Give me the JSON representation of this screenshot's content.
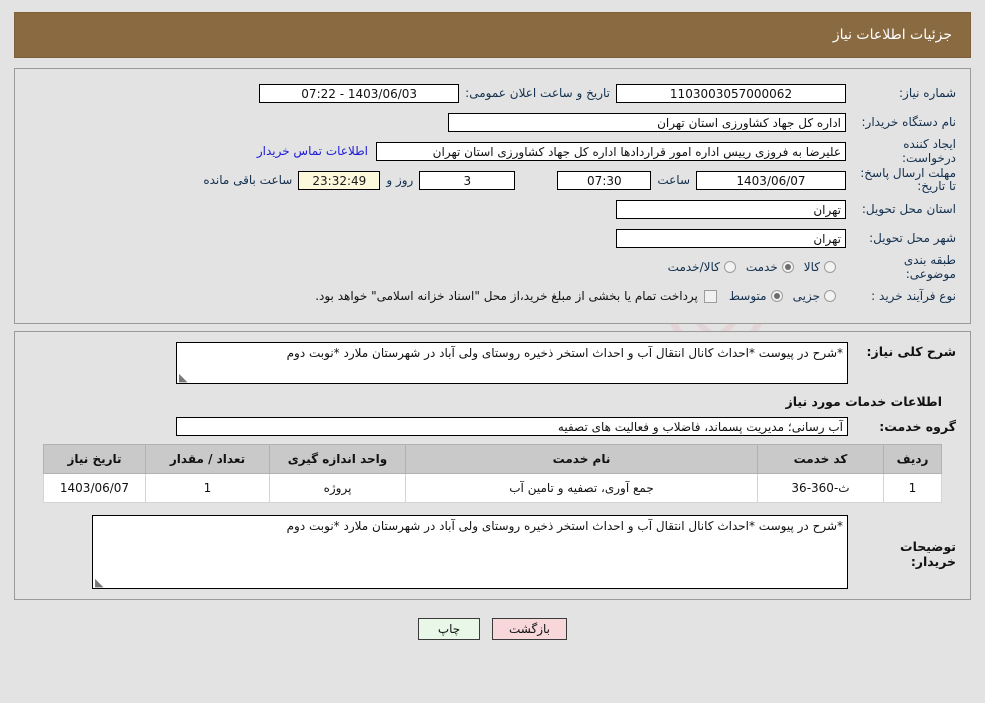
{
  "header": {
    "title": "جزئیات اطلاعات نیاز",
    "bg_color": "#8a6b41"
  },
  "info": {
    "need_number_label": "شماره نیاز:",
    "need_number_value": "1103003057000062",
    "announce_label": "تاریخ و ساعت اعلان عمومی:",
    "announce_value": "1403/06/03 - 07:22",
    "buyer_org_label": "نام دستگاه خریدار:",
    "buyer_org_value": "اداره کل جهاد کشاورزی استان تهران",
    "requester_label": "ایجاد کننده درخواست:",
    "requester_value": "علیرضا به فروزی رییس اداره امور قراردادها اداره کل جهاد کشاورزی استان تهران",
    "contact_link": "اطلاعات تماس خریدار",
    "deadline_label": "مهلت ارسال پاسخ: تا تاریخ:",
    "deadline_date": "1403/06/07",
    "hour_label": "ساعت",
    "deadline_time": "07:30",
    "days_value": "3",
    "days_label": "روز و",
    "countdown_value": "23:32:49",
    "countdown_label": "ساعت باقی مانده",
    "province_label": "استان محل تحویل:",
    "province_value": "تهران",
    "city_label": "شهر محل تحویل:",
    "city_value": "تهران",
    "classification_label": "طبقه بندی موضوعی:",
    "classification_options": [
      {
        "label": "کالا",
        "selected": false
      },
      {
        "label": "خدمت",
        "selected": true
      },
      {
        "label": "کالا/خدمت",
        "selected": false
      }
    ],
    "process_label": "نوع فرآیند خرید :",
    "process_options": [
      {
        "label": "جزیی",
        "selected": false
      },
      {
        "label": "متوسط",
        "selected": true
      }
    ],
    "treasury_checkbox_checked": false,
    "treasury_text": "پرداخت تمام یا بخشی از مبلغ خرید،از محل \"اسناد خزانه اسلامی\" خواهد بود."
  },
  "need_desc": {
    "label": "شرح کلی نیاز:",
    "value": "*شرح در پیوست *احداث کانال انتقال آب و احداث استخر ذخیره روستای ولی آباد  در شهرستان ملارد *نوبت دوم"
  },
  "services_section": {
    "heading": "اطلاعات خدمات مورد نیاز",
    "group_label": "گروه خدمت:",
    "group_value": "آب رسانی؛ مدیریت پسماند، فاضلاب و فعالیت های تصفیه"
  },
  "items_table": {
    "columns": [
      "ردیف",
      "کد خدمت",
      "نام خدمت",
      "واحد اندازه گیری",
      "تعداد / مقدار",
      "تاریخ نیاز"
    ],
    "rows": [
      [
        "1",
        "ث-360-36",
        "جمع آوری، تصفیه و تامین آب",
        "پروژه",
        "1",
        "1403/06/07"
      ]
    ]
  },
  "buyer_notes": {
    "label": "توضیحات خریدار:",
    "value": "*شرح در پیوست *احداث کانال انتقال آب و احداث استخر ذخیره روستای ولی آباد  در شهرستان ملارد *نوبت دوم"
  },
  "buttons": {
    "back": "بازگشت",
    "print": "چاپ"
  },
  "watermark": {
    "text": "AriaTender.net"
  }
}
